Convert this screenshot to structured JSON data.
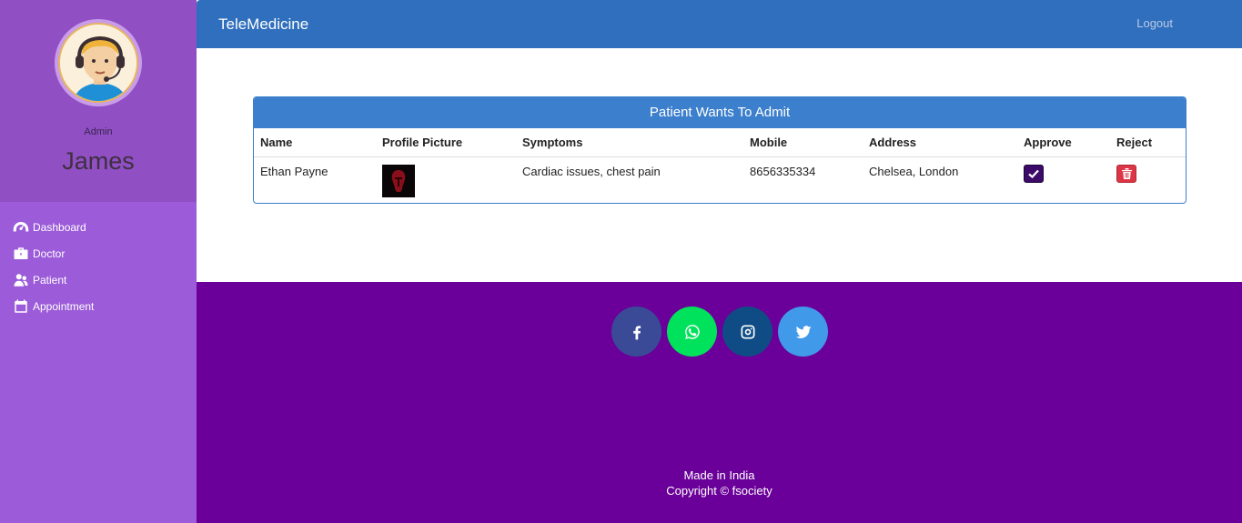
{
  "sidebar": {
    "role": "Admin",
    "username": "James",
    "items": [
      {
        "label": "Dashboard",
        "icon": "dashboard-icon"
      },
      {
        "label": "Doctor",
        "icon": "briefcase-icon"
      },
      {
        "label": "Patient",
        "icon": "users-icon"
      },
      {
        "label": "Appointment",
        "icon": "calendar-icon"
      }
    ]
  },
  "header": {
    "brand": "TeleMedicine",
    "logout": "Logout"
  },
  "panel": {
    "title": "Patient Wants To Admit",
    "columns": [
      "Name",
      "Profile Picture",
      "Symptoms",
      "Mobile",
      "Address",
      "Approve",
      "Reject"
    ],
    "rows": [
      {
        "name": "Ethan Payne",
        "symptoms": "Cardiac issues, chest pain",
        "mobile": "8656335334",
        "address": "Chelsea, London"
      }
    ]
  },
  "footer": {
    "socials": [
      {
        "name": "facebook",
        "color": "#3b4a97"
      },
      {
        "name": "whatsapp",
        "color": "#00e25b"
      },
      {
        "name": "instagram",
        "color": "#0f4c85"
      },
      {
        "name": "twitter",
        "color": "#4199ea"
      }
    ],
    "made_in": "Made in India",
    "copyright": "Copyright © fsociety"
  },
  "colors": {
    "sidebar": "#9c5bd9",
    "sidebar_profile": "#914fc4",
    "header": "#2f6fbd",
    "panel_heading": "#3c7fcd",
    "footer": "#6a0099",
    "approve": "#3c0a68",
    "reject": "#dc3545"
  }
}
